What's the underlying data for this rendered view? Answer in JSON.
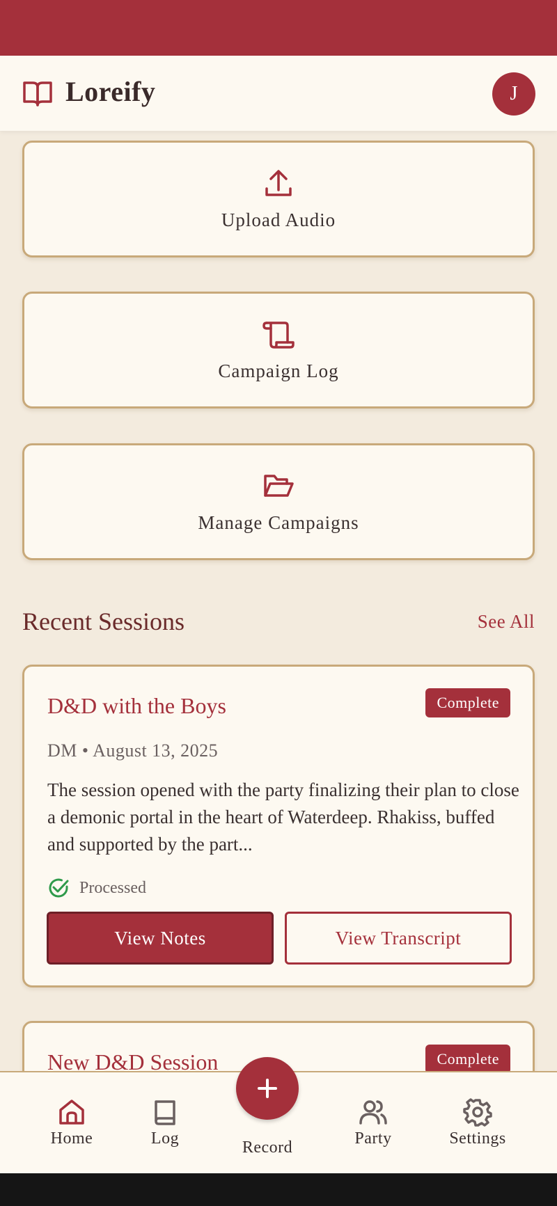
{
  "app": {
    "title": "Loreify",
    "avatar_initial": "J"
  },
  "actions": [
    {
      "label": "Upload Audio",
      "icon": "upload-icon"
    },
    {
      "label": "Campaign Log",
      "icon": "scroll-icon"
    },
    {
      "label": "Manage Campaigns",
      "icon": "folder-open-icon"
    }
  ],
  "recent": {
    "title": "Recent Sessions",
    "see_all": "See All"
  },
  "sessions": [
    {
      "title": "D&D with the Boys",
      "badge": "Complete",
      "meta": "DM • August 13, 2025",
      "summary": "The session opened with the party finalizing their plan to close a demonic portal in the heart of Waterdeep. Rhakiss, buffed and supported by the part...",
      "status": "Processed",
      "view_notes": "View Notes",
      "view_transcript": "View Transcript"
    },
    {
      "title": "New D&D Session",
      "badge": "Complete"
    }
  ],
  "nav": {
    "home": "Home",
    "log": "Log",
    "record": "Record",
    "party": "Party",
    "settings": "Settings"
  },
  "colors": {
    "accent": "#a4303b",
    "border": "#c8a97a",
    "background": "#f3ebde",
    "card": "#fdf9f1",
    "success": "#2e9a4a"
  }
}
